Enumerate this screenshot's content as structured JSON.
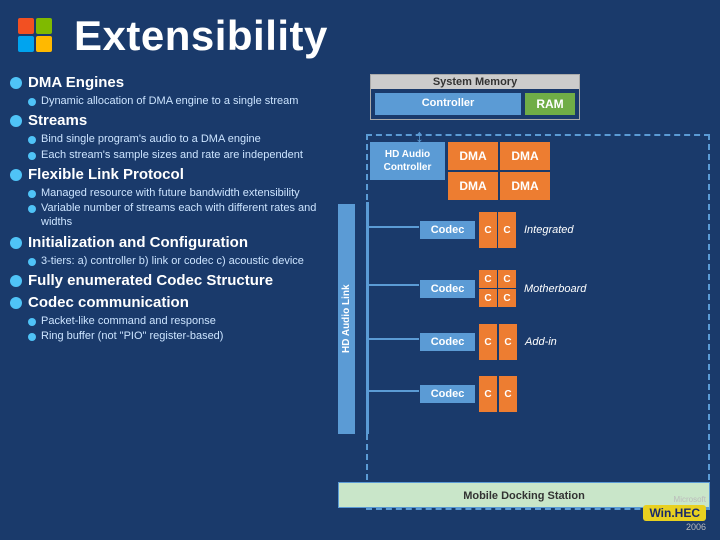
{
  "header": {
    "title": "Extensibility"
  },
  "bullets": [
    {
      "id": "dma-engines",
      "label": "DMA Engines",
      "subs": [
        "Dynamic allocation of DMA engine to a single stream"
      ]
    },
    {
      "id": "streams",
      "label": "Streams",
      "subs": [
        "Bind single program's audio to a DMA engine",
        "Each stream's sample sizes and rate are independent"
      ]
    },
    {
      "id": "flexible-link",
      "label": "Flexible Link Protocol",
      "subs": [
        "Managed resource with future bandwidth extensibility",
        "Variable number of streams each with different rates and widths"
      ]
    },
    {
      "id": "init-config",
      "label": "Initialization and Configuration",
      "subs": [
        "3-tiers: a) controller  b) link or codec c) acoustic device"
      ]
    },
    {
      "id": "codec-struct",
      "label": "Fully enumerated Codec Structure",
      "subs": []
    },
    {
      "id": "codec-comm",
      "label": "Codec communication",
      "subs": [
        "Packet-like command and response",
        "Ring buffer (not \"PIO\" register-based)"
      ]
    }
  ],
  "diagram": {
    "system_memory_label": "System Memory",
    "controller_label": "Controller",
    "ram_label": "RAM",
    "hd_audio_ctrl_label": "HD Audio Controller",
    "dma_cells": [
      "DMA",
      "DMA",
      "DMA",
      "DMA"
    ],
    "hd_audio_link_label": "HD Audio Link",
    "codec_label": "Codec",
    "integrated_label": "Integrated",
    "motherboard_label": "Motherboard",
    "addin_label": "Add-in",
    "mobile_docking_label": "Mobile Docking Station"
  },
  "footer": {
    "microsoft": "Microsoft",
    "winhec": "Win.HEC",
    "year": "2006"
  }
}
